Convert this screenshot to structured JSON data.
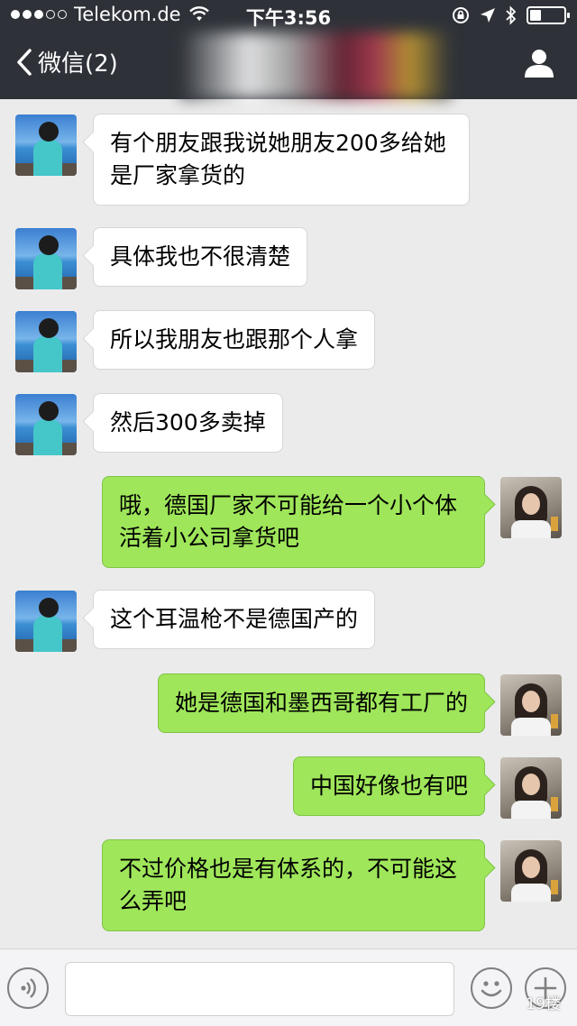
{
  "status": {
    "carrier": "Telekom.de",
    "time": "下午3:56"
  },
  "nav": {
    "back_label": "微信(2)"
  },
  "colors": {
    "topbar": "#2e3238",
    "chat_bg": "#ebebeb",
    "incoming_bubble": "#ffffff",
    "outgoing_bubble": "#9fe65a"
  },
  "messages": [
    {
      "side": "in",
      "text": "有个朋友跟我说她朋友200多给她 是厂家拿货的"
    },
    {
      "side": "in",
      "text": "具体我也不很清楚"
    },
    {
      "side": "in",
      "text": "所以我朋友也跟那个人拿"
    },
    {
      "side": "in",
      "text": "然后300多卖掉"
    },
    {
      "side": "out",
      "text": "哦，德国厂家不可能给一个小个体活着小公司拿货吧"
    },
    {
      "side": "in",
      "text": "这个耳温枪不是德国产的"
    },
    {
      "side": "out",
      "text": "她是德国和墨西哥都有工厂的"
    },
    {
      "side": "out",
      "text": "中国好像也有吧"
    },
    {
      "side": "out",
      "text": "不过价格也是有体系的，不可能这么弄吧"
    }
  ],
  "input": {
    "value": ""
  },
  "watermark": "19楼"
}
